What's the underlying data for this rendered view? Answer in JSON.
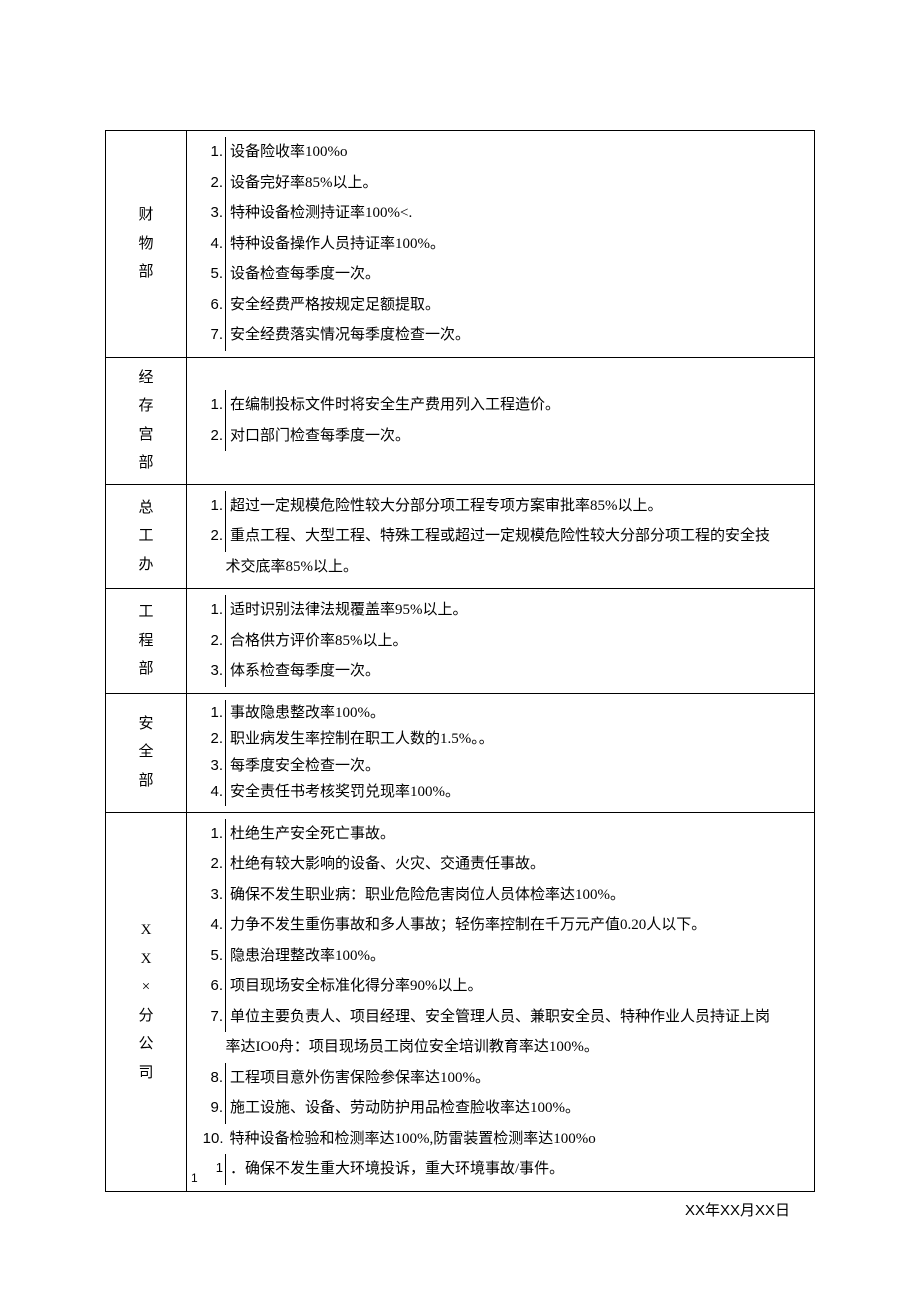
{
  "rows": [
    {
      "dept": "财物部",
      "style": "spaced",
      "items": [
        {
          "n": "1.",
          "t": "设备险收率100%o"
        },
        {
          "n": "2.",
          "t": "设备完好率85%以上。"
        },
        {
          "n": "3.",
          "t": "特种设备检测持证率100%<."
        },
        {
          "n": "4.",
          "t": "特种设备操作人员持证率100%。"
        },
        {
          "n": "5.",
          "t": "设备检查每季度一次。"
        },
        {
          "n": "6.",
          "t": "安全经费严格按规定足额提取。"
        },
        {
          "n": "7.",
          "t": "安全经费落实情况每季度检查一次。"
        }
      ]
    },
    {
      "dept": "经存宫部",
      "style": "spaced",
      "items": [
        {
          "n": "1.",
          "t": "在编制投标文件时将安全生产费用列入工程造价。"
        },
        {
          "n": "2.",
          "t": "对口部门检查每季度一次。"
        }
      ]
    },
    {
      "dept": "总工办",
      "style": "spaced",
      "wrap": true,
      "items": [
        {
          "n": "1.",
          "t": "超过一定规模危险性较大分部分项工程专项方案审批率85%以上。"
        },
        {
          "n": "2.",
          "t": "重点工程、大型工程、特殊工程或超过一定规模危险性较大分部分项工程的安全技",
          "cont": "术交底率85%以上。"
        }
      ]
    },
    {
      "dept": "工程部",
      "style": "spaced",
      "items": [
        {
          "n": "1.",
          "t": "适时识别法律法规覆盖率95%以上。"
        },
        {
          "n": "2.",
          "t": "合格供方评价率85%以上。"
        },
        {
          "n": "3.",
          "t": "体系检查每季度一次。"
        }
      ]
    },
    {
      "dept": "安全部",
      "style": "tight",
      "items": [
        {
          "n": "1.",
          "t": "事故隐患整改率100%。"
        },
        {
          "n": "2.",
          "t": "职业病发生率控制在职工人数的1.5%。。"
        },
        {
          "n": "3.",
          "t": "每季度安全检查一次。"
        },
        {
          "n": "4.",
          "t": "安全责任书考核奖罚兑现率100%。"
        }
      ]
    },
    {
      "dept": "X X × 分公司",
      "style": "spaced",
      "wrap": true,
      "items": [
        {
          "n": "1.",
          "t": "杜绝生产安全死亡事故。"
        },
        {
          "n": "2.",
          "t": "杜绝有较大影响的设备、火灾、交通责任事故。"
        },
        {
          "n": "3.",
          "t": "确保不发生职业病：职业危险危害岗位人员体检率达100%。"
        },
        {
          "n": "4.",
          "t": "力争不发生重伤事故和多人事故；轻伤率控制在千万元产值0.20人以下。"
        },
        {
          "n": "5.",
          "t": "隐患治理整改率100%。"
        },
        {
          "n": "6.",
          "t": "项目现场安全标准化得分率90%以上。"
        },
        {
          "n": "7.",
          "t": "单位主要负责人、项目经理、安全管理人员、兼职安全员、特种作业人员持证上岗",
          "cont": "率达IO0舟：项目现场员工岗位安全培训教育率达100%。"
        },
        {
          "n": "8.",
          "t": "工程项目意外伤害保险参保率达100%。"
        },
        {
          "n": "9.",
          "t": "施工设施、设备、劳动防护用品检查脸收率达100%。"
        },
        {
          "n": "10.",
          "t": "特种设备检验和检测率达100%,防雷装置检测率达100%o",
          "noborder": true
        },
        {
          "n": "1",
          "t": "．确保不发生重大环境投诉，重大环境事故/事件。",
          "foot": true,
          "noborder": false
        }
      ]
    }
  ],
  "footer_date": "XX年XX月XX日"
}
